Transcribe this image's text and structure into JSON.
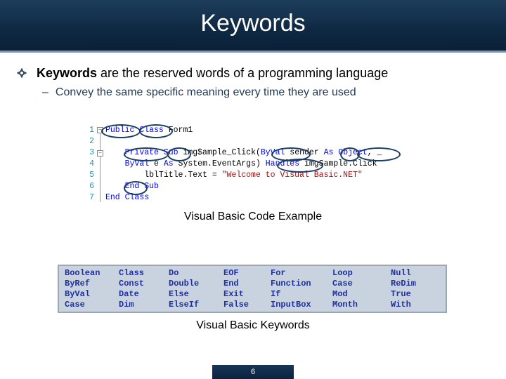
{
  "slide": {
    "title": "Keywords",
    "bullet": {
      "bold": "Keywords",
      "rest": " are the reserved words of a programming language"
    },
    "sub_bullet": {
      "dash": "–",
      "text": "Convey the same specific meaning every time they are used"
    },
    "code_caption": "Visual Basic Code Example",
    "keywords_caption": "Visual Basic Keywords",
    "page_number": "6"
  },
  "code": {
    "lines": [
      {
        "n": "1",
        "segments": [
          {
            "t": "Public",
            "c": "kw"
          },
          {
            "t": " ",
            "c": "plain"
          },
          {
            "t": "Class",
            "c": "kw"
          },
          {
            "t": " Form1",
            "c": "plain"
          }
        ]
      },
      {
        "n": "2",
        "segments": []
      },
      {
        "n": "3",
        "segments": [
          {
            "t": "    ",
            "c": "plain"
          },
          {
            "t": "Private",
            "c": "kw"
          },
          {
            "t": " ",
            "c": "plain"
          },
          {
            "t": "Sub",
            "c": "kw"
          },
          {
            "t": " img$ample_Click(",
            "c": "plain"
          },
          {
            "t": "ByVal",
            "c": "kw"
          },
          {
            "t": " sender ",
            "c": "plain"
          },
          {
            "t": "As",
            "c": "kw"
          },
          {
            "t": " ",
            "c": "plain"
          },
          {
            "t": "Object",
            "c": "kw"
          },
          {
            "t": ", _",
            "c": "plain"
          }
        ]
      },
      {
        "n": "4",
        "segments": [
          {
            "t": "    ",
            "c": "plain"
          },
          {
            "t": "ByVal",
            "c": "kw"
          },
          {
            "t": " e ",
            "c": "plain"
          },
          {
            "t": "As",
            "c": "kw"
          },
          {
            "t": " System.EventArgs) ",
            "c": "plain"
          },
          {
            "t": "Handles",
            "c": "kw"
          },
          {
            "t": " imgSample.Click",
            "c": "plain"
          }
        ]
      },
      {
        "n": "5",
        "segments": [
          {
            "t": "        lblTitle.Text = ",
            "c": "plain"
          },
          {
            "t": "\"Welcome to Visual Basic.NET\"",
            "c": "str"
          }
        ]
      },
      {
        "n": "6",
        "segments": [
          {
            "t": "    ",
            "c": "plain"
          },
          {
            "t": "End",
            "c": "kw"
          },
          {
            "t": " ",
            "c": "plain"
          },
          {
            "t": "Sub",
            "c": "kw"
          }
        ]
      },
      {
        "n": "7",
        "segments": [
          {
            "t": "End",
            "c": "kw"
          },
          {
            "t": " ",
            "c": "plain"
          },
          {
            "t": "Class",
            "c": "kw"
          }
        ]
      }
    ]
  },
  "keyword_table": {
    "columns": [
      [
        "Boolean",
        "ByRef",
        "ByVal",
        "Case"
      ],
      [
        "Class",
        "Const",
        "Date",
        "Dim"
      ],
      [
        "Do",
        "Double",
        "Else",
        "ElseIf"
      ],
      [
        "EOF",
        "End",
        "Exit",
        "False"
      ],
      [
        "For",
        "Function",
        "If",
        "InputBox"
      ],
      [
        "Loop",
        "Case",
        "Mod",
        "Month"
      ],
      [
        "Null",
        "ReDim",
        "True",
        "With"
      ]
    ]
  },
  "colors": {
    "title_bar": "#0f2a44",
    "keyword_blue": "#0000ff",
    "string_red": "#a31515",
    "table_bg": "#c9d3e0",
    "table_text": "#1f2f9f"
  }
}
